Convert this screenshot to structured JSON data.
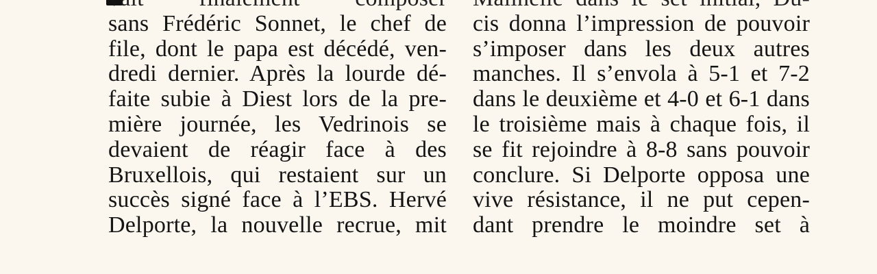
{
  "document": {
    "columns": [
      {
        "lines": [
          "vait finalement composer",
          "sans Frédéric Sonnet, le chef de",
          "file, dont le papa est décédé, ven-",
          "dredi dernier. Après la lourde dé-",
          "faite subie à Diest lors de la pre-",
          "mière journée, les Vedrinois se",
          "devaient de réagir face à des",
          "Bruxellois, qui restaient sur un",
          "succès signé face à l’EBS. Hervé",
          "Delporte, la nouvelle recrue, mit"
        ]
      },
      {
        "lines": [
          "Malinelle dans le set initial, Du-",
          "cis donna l’impression de pouvoir",
          "s’imposer dans les deux autres",
          "manches. Il s’envola à 5-1 et 7-2",
          "dans le deuxième et 4-0 et 6-1 dans",
          "le troisième mais à chaque fois, il",
          "se fit rejoindre à 8-8 sans pouvoir",
          "conclure. Si Delporte opposa une",
          "vive résistance, il ne put cepen-",
          "dant prendre le moindre set à"
        ]
      }
    ]
  }
}
